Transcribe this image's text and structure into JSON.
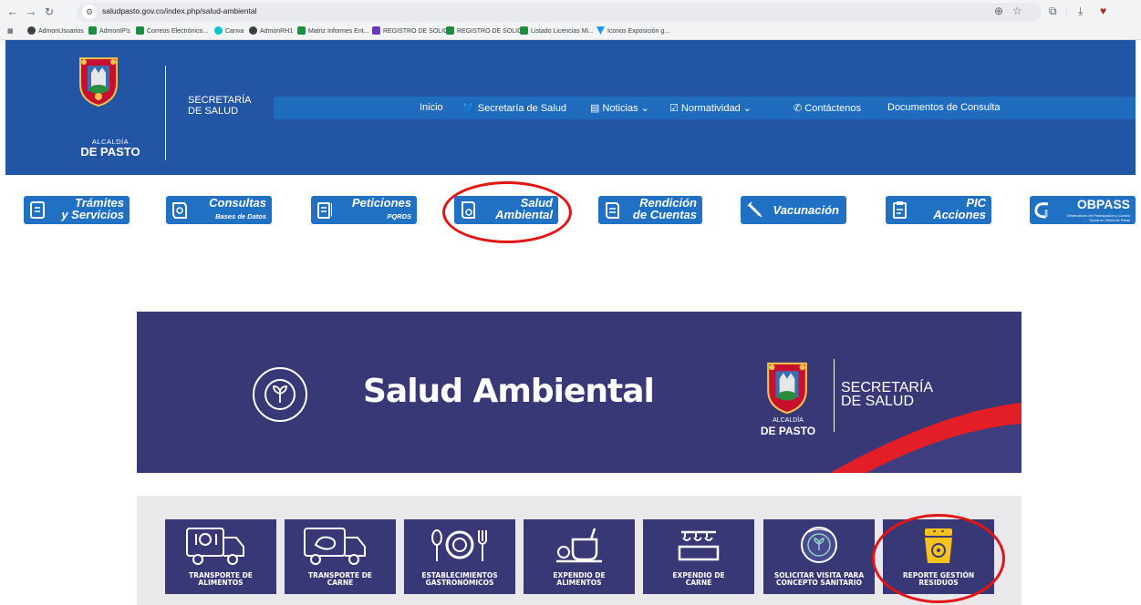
{
  "browser": {
    "url": "saludpasto.gov.co/index.php/salud-ambiental",
    "bookmarks": [
      {
        "label": "AdmonUsuarios",
        "color": "#3c4043"
      },
      {
        "label": "AdmonIP's",
        "color": "#1e8e3e"
      },
      {
        "label": "Correos Electrónico...",
        "color": "#1e8e3e"
      },
      {
        "label": "Canva",
        "color": "#00c4cc"
      },
      {
        "label": "AdmonRH1",
        "color": "#3c4043"
      },
      {
        "label": "Matriz Informes Ent...",
        "color": "#1e8e3e"
      },
      {
        "label": "REGISTRO DE SOLIC...",
        "color": "#673ab7"
      },
      {
        "label": "REGISTRO DE SOLIC...",
        "color": "#1e8e3e"
      },
      {
        "label": "Listado Licencias Mi...",
        "color": "#1e8e3e"
      },
      {
        "label": "Iconos Exposición g...",
        "color": "#2196f3"
      }
    ]
  },
  "header": {
    "alcaldia": "ALCALDÍA",
    "pasto": "DE PASTO",
    "secretaria_line1": "SECRETARÍA",
    "secretaria_line2": "DE SALUD",
    "menu": [
      {
        "label": "Inicio"
      },
      {
        "label": "💙 Secretaría de Salud"
      },
      {
        "label": "▤ Noticias ⌄"
      },
      {
        "label": "☑ Normatividad ⌄"
      },
      {
        "label": "✆ Contáctenos"
      },
      {
        "label": "Documentos de Consulta"
      }
    ]
  },
  "quick_links": [
    {
      "line1": "Trámites",
      "line2": "y Servicios"
    },
    {
      "line1": "Consultas",
      "line2": "Bases de Datos"
    },
    {
      "line1": "Peticiones",
      "line2": "PQRDS"
    },
    {
      "line1": "Salud",
      "line2": "Ambiental"
    },
    {
      "line1": "Rendición",
      "line2": "de Cuentas"
    },
    {
      "line1": "Vacunación",
      "line2": ""
    },
    {
      "line1": "PIC",
      "line2": "Acciones"
    },
    {
      "line1": "OBPASS",
      "line2": "Observatorio de Participación y Control Social en Salud de Pasto"
    }
  ],
  "banner": {
    "title": "Salud Ambiental",
    "secretaria_line1": "SECRETARÍA",
    "secretaria_line2": "DE SALUD",
    "alcaldia": "ALCALDÍA",
    "pasto": "DE PASTO"
  },
  "services": [
    {
      "line1": "TRANSPORTE DE",
      "line2": "ALIMENTOS"
    },
    {
      "line1": "TRANSPORTE DE",
      "line2": "CARNE"
    },
    {
      "line1": "ESTABLECIMIENTOS",
      "line2": "GASTRONÓMICOS"
    },
    {
      "line1": "EXPENDIO DE",
      "line2": "ALIMENTOS"
    },
    {
      "line1": "EXPENDIO DE",
      "line2": "CARNE"
    },
    {
      "line1": "SOLICITAR VISITA PARA",
      "line2": "CONCEPTO SANITARIO"
    },
    {
      "line1": "REPORTE GESTIÓN",
      "line2": "RESIDUOS"
    }
  ],
  "colors": {
    "header_blue": "#2255a4",
    "menu_blue": "#1f6bbd",
    "button_blue": "#2071c4",
    "banner_navy": "#383876",
    "highlight_red": "#e31414"
  }
}
